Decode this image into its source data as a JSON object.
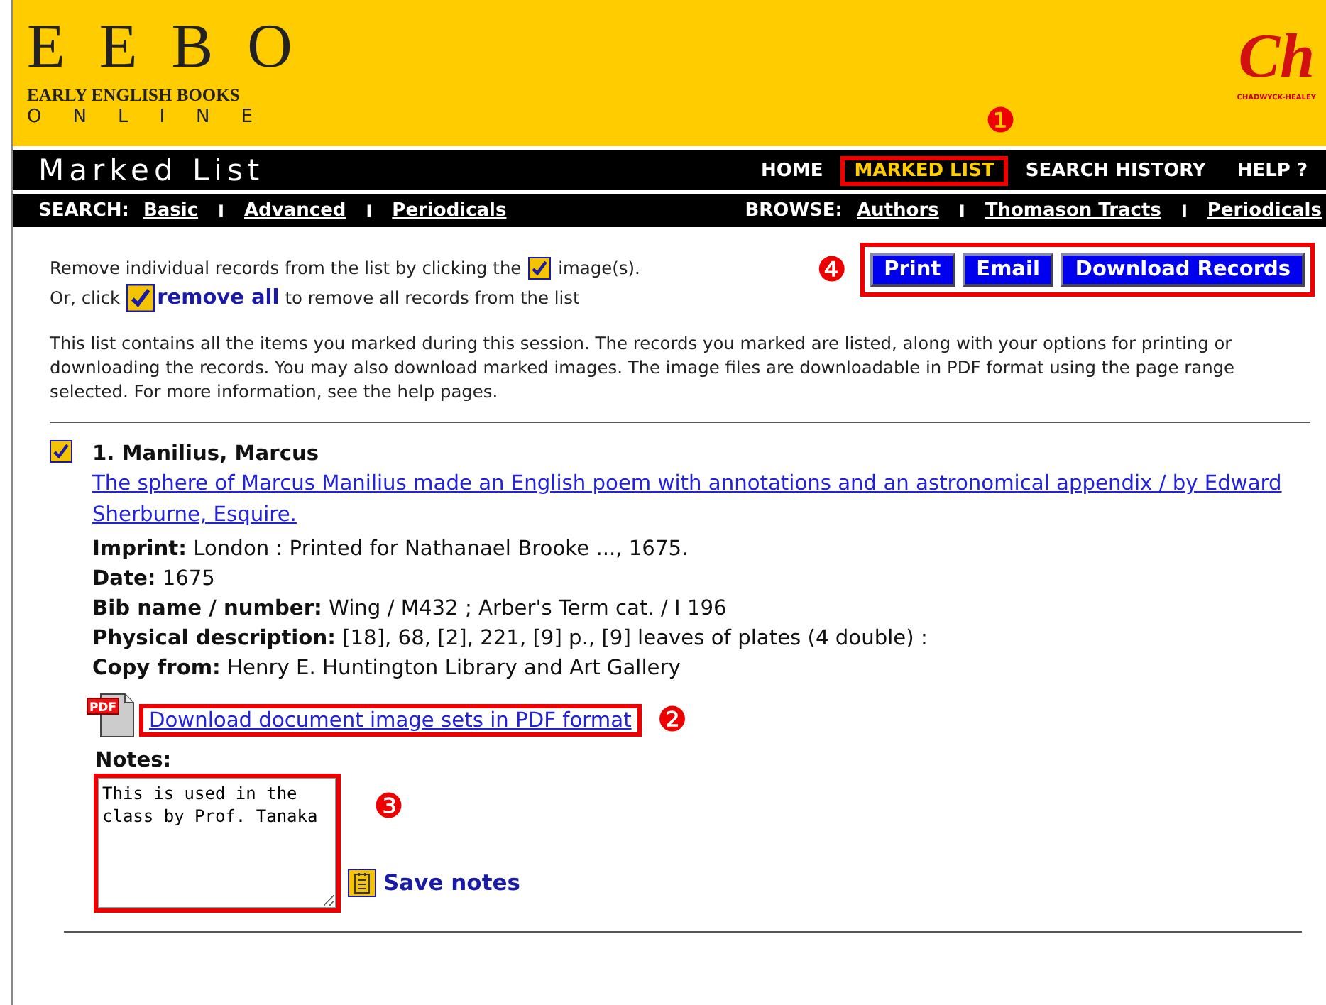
{
  "header": {
    "logo_title": "EEBO",
    "logo_subtitle": "EARLY ENGLISH BOOKS",
    "logo_line3": "ONLINE",
    "publisher_mark": "Ch",
    "publisher_name": "CHADWYCK-HEALEY"
  },
  "title_bar": {
    "title": "Marked List",
    "links": [
      {
        "label": "HOME",
        "selected": false,
        "highlighted": false
      },
      {
        "label": "MARKED LIST",
        "selected": true,
        "highlighted": true,
        "callout": "❶"
      },
      {
        "label": "SEARCH HISTORY",
        "selected": false,
        "highlighted": false
      },
      {
        "label": "HELP ?",
        "selected": false,
        "highlighted": false
      }
    ]
  },
  "search_bar": {
    "search_label": "SEARCH:",
    "search_links": [
      "Basic",
      "Advanced",
      "Periodicals"
    ],
    "browse_label": "BROWSE:",
    "browse_links": [
      "Authors",
      "Thomason Tracts",
      "Periodicals"
    ],
    "search_separators": [
      "I",
      "I"
    ],
    "browse_separators": [
      "I",
      "I"
    ]
  },
  "instructions": {
    "line1_before": "Remove individual records from the list by clicking the",
    "line1_after": "image(s).",
    "line2_before": "Or, click",
    "remove_all": "remove all",
    "line2_after": "to remove all records from the list",
    "description": "This list contains all the items you marked during this session. The records you marked are listed, along with your options for printing or downloading the records. You may also download marked images. The image files are downloadable in PDF format using the page range selected. For more information, see the help pages."
  },
  "actions": {
    "callout": "❹",
    "highlighted": true,
    "buttons": [
      "Print",
      "Email",
      "Download Records"
    ]
  },
  "records": [
    {
      "checked": true,
      "heading": "1. Manilius, Marcus",
      "title": "The sphere of Marcus Manilius made an English poem with annotations and an astronomical appendix / by Edward Sherburne, Esquire.",
      "fields": [
        {
          "label": "Imprint:",
          "value": "London : Printed for Nathanael Brooke ..., 1675."
        },
        {
          "label": "Date:",
          "value": "1675"
        },
        {
          "label": "Bib name / number:",
          "value": "Wing / M432 ; Arber's Term cat. / I 196"
        },
        {
          "label": "Physical description:",
          "value": "[18], 68, [2], 221, [9] p., [9] leaves of plates (4 double) :"
        },
        {
          "label": "Copy from:",
          "value": "Henry E. Huntington Library and Art Gallery"
        }
      ],
      "pdf_badge": "PDF",
      "pdf_link": "Download document image sets in PDF format",
      "pdf_highlighted": true,
      "pdf_callout": "❷",
      "notes_label": "Notes:",
      "notes_value": "This is used in the\nclass by Prof. Tanaka",
      "notes_highlighted": true,
      "notes_callout": "❸",
      "save_label": "Save notes"
    }
  ]
}
